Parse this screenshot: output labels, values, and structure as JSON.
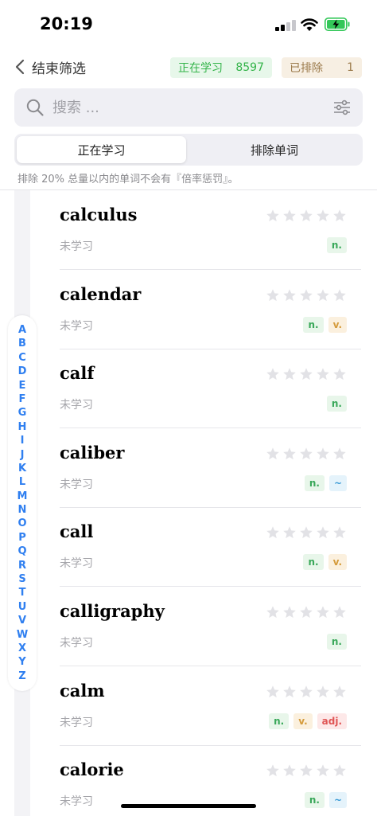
{
  "status_bar": {
    "time": "20:19"
  },
  "nav": {
    "back_label": "结束筛选",
    "learning_badge": {
      "label": "正在学习",
      "count": "8597"
    },
    "excluded_badge": {
      "label": "已排除",
      "count": "1"
    }
  },
  "search": {
    "placeholder": "搜索 ..."
  },
  "tabs": [
    {
      "label": "正在学习",
      "selected": true
    },
    {
      "label": "排除单词",
      "selected": false
    }
  ],
  "hint": "排除 20% 总量以内的单词不会有『倍率惩罚』。",
  "index_letters": [
    "A",
    "B",
    "C",
    "D",
    "E",
    "F",
    "G",
    "H",
    "I",
    "J",
    "K",
    "L",
    "M",
    "N",
    "O",
    "P",
    "Q",
    "R",
    "S",
    "T",
    "U",
    "V",
    "W",
    "X",
    "Y",
    "Z"
  ],
  "words": [
    {
      "word": "calculus",
      "status": "未学习",
      "stars": 0,
      "pos": [
        "n."
      ]
    },
    {
      "word": "calendar",
      "status": "未学习",
      "stars": 0,
      "pos": [
        "n.",
        "v."
      ]
    },
    {
      "word": "calf",
      "status": "未学习",
      "stars": 0,
      "pos": [
        "n."
      ]
    },
    {
      "word": "caliber",
      "status": "未学习",
      "stars": 0,
      "pos": [
        "n.",
        "~"
      ]
    },
    {
      "word": "call",
      "status": "未学习",
      "stars": 0,
      "pos": [
        "n.",
        "v."
      ]
    },
    {
      "word": "calligraphy",
      "status": "未学习",
      "stars": 0,
      "pos": [
        "n."
      ]
    },
    {
      "word": "calm",
      "status": "未学习",
      "stars": 0,
      "pos": [
        "n.",
        "v.",
        "adj."
      ]
    },
    {
      "word": "calorie",
      "status": "未学习",
      "stars": 0,
      "pos": [
        "n.",
        "~"
      ]
    }
  ],
  "colors": {
    "accent_blue": "#2f7ff0",
    "learning_green": "#34b44a",
    "excluded_brown": "#9b7a4b",
    "star_gray": "#e2e2e6"
  }
}
